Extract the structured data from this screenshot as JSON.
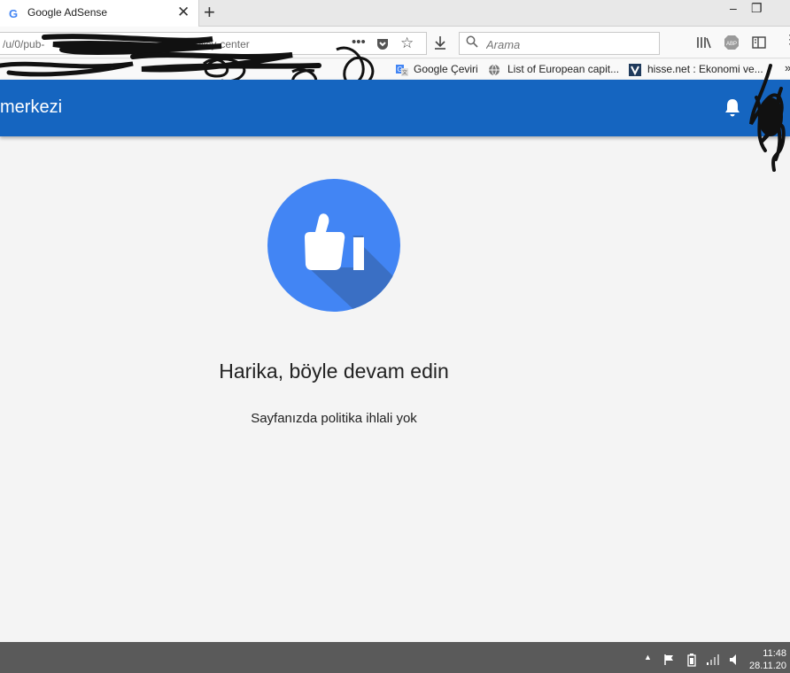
{
  "browser": {
    "tab_title": "Google AdSense",
    "url_text": "/u/0/pub-",
    "url_suffix": "/policy-center",
    "search_placeholder": "Arama",
    "bookmarks": [
      {
        "label": "Google Çeviri",
        "icon": "google-translate-icon"
      },
      {
        "label": "List of European capit...",
        "icon": "globe-icon"
      },
      {
        "label": "hisse.net : Ekonomi ve...",
        "icon": "hisse-net-icon"
      }
    ]
  },
  "app": {
    "title": "merkezi",
    "accent": "#1565c0"
  },
  "content": {
    "icon": "thumbs-up-icon",
    "circle_color": "#4285f4",
    "heading": "Harika, böyle devam edin",
    "message": "Sayfanızda politika ihlali yok"
  },
  "taskbar": {
    "time": "11:48",
    "date": "28.11.20"
  }
}
